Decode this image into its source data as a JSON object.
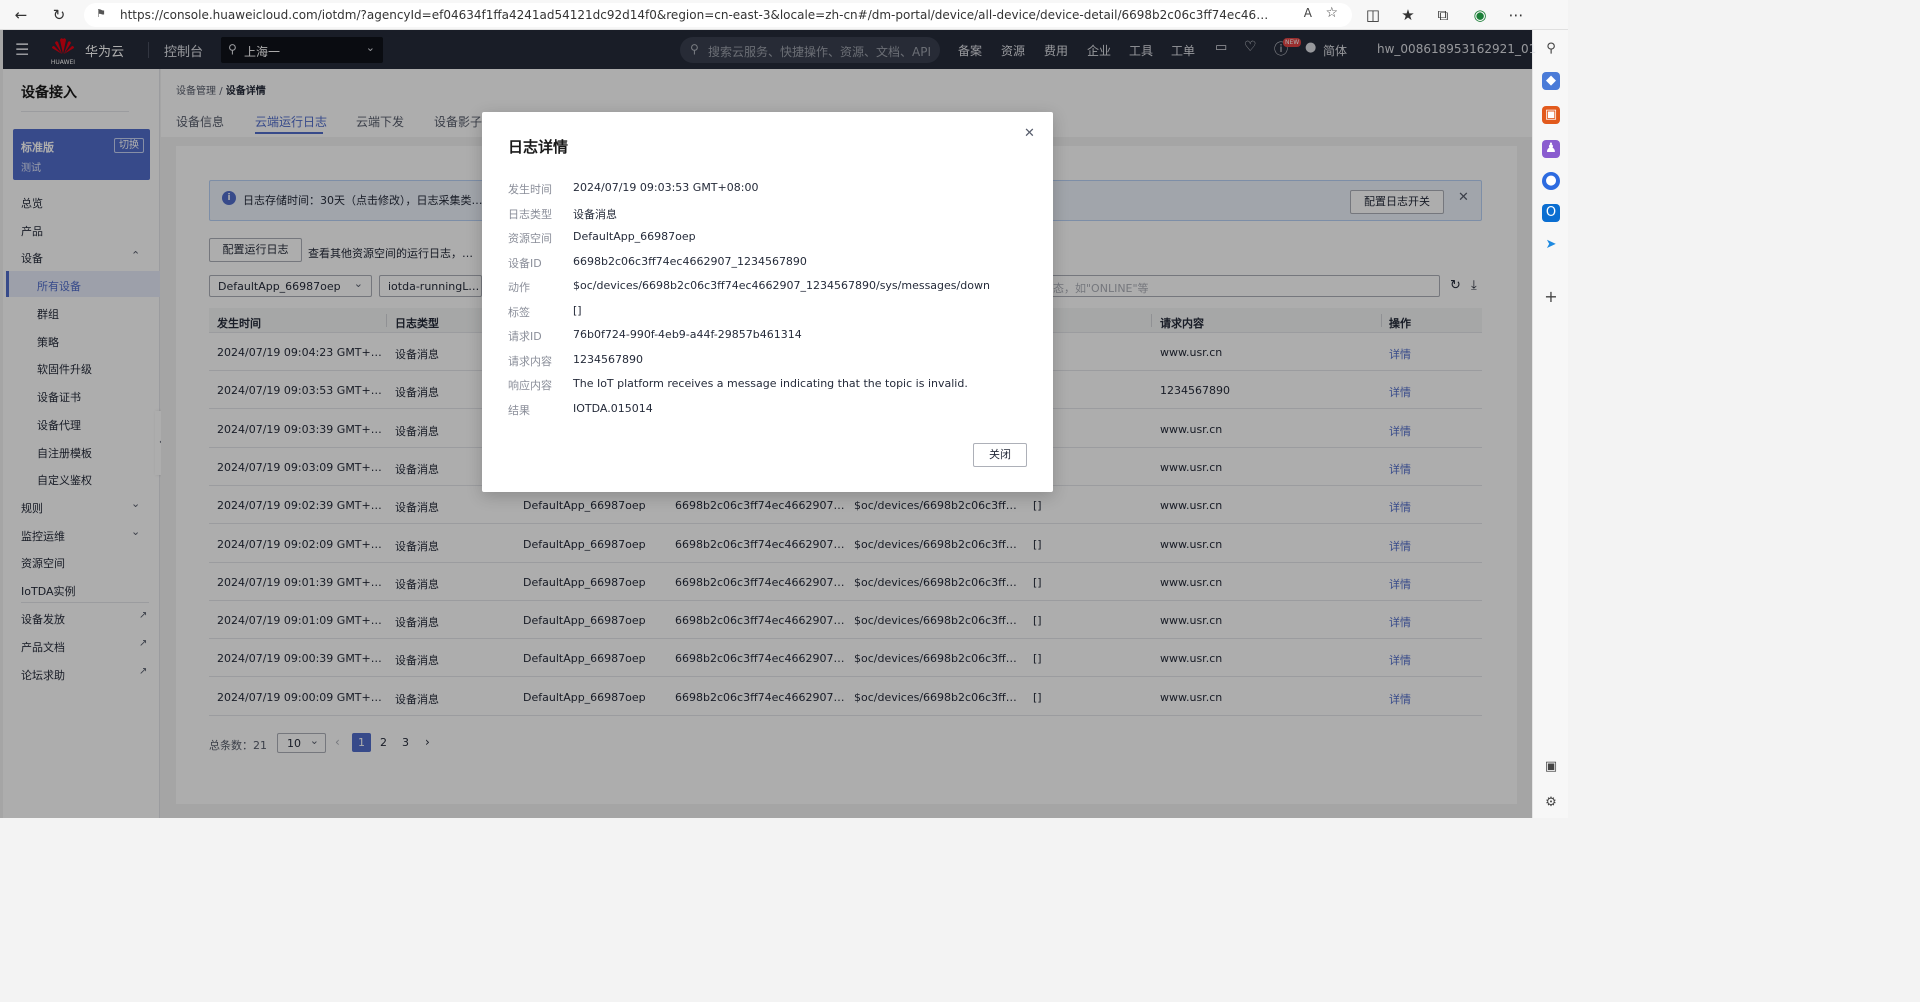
{
  "browser": {
    "url": "https://console.huaweicloud.com/iotdm/?agencyId=ef04634f1ffa4241ad54121dc92d14f0&region=cn-east-3&locale=zh-cn#/dm-portal/device/all-device/device-detail/6698b2c06c3ff74ec4662907_1234567890?appId=2ef6f4c35f..."
  },
  "header": {
    "brand": "华为云",
    "logo_text": "HUAWEI",
    "console": "控制台",
    "region": "上海一",
    "search_placeholder": "搜索云服务、快捷操作、资源、文档、API",
    "nav": [
      "备案",
      "资源",
      "费用",
      "企业",
      "工具",
      "工单"
    ],
    "new_badge": "NEW",
    "lang": "简体",
    "user": "hw_008618953162921_01"
  },
  "sidebar": {
    "title": "设备接入",
    "edition": "标准版",
    "switch_label": "切换",
    "instance": "测试",
    "items": {
      "overview": "总览",
      "product": "产品",
      "device": "设备",
      "all_devices": "所有设备",
      "group": "群组",
      "policy": "策略",
      "firmware": "软固件升级",
      "cert": "设备证书",
      "proxy": "设备代理",
      "self_reg": "自注册模板",
      "custom_auth": "自定义鉴权",
      "rules": "规则",
      "monitor": "监控运维",
      "resource_space": "资源空间",
      "iotda_instance": "IoTDA实例",
      "provisioning": "设备发放",
      "product_docs": "产品文档",
      "forum": "论坛求助"
    }
  },
  "breadcrumb": {
    "parent": "设备管理",
    "sep": "/",
    "current": "设备详情"
  },
  "tabs": [
    "设备信息",
    "云端运行日志",
    "云端下发",
    "设备影子"
  ],
  "notice": {
    "text": "日志存储时间：30天（点击修改），日志采集类型开启",
    "config_button": "配置日志开关"
  },
  "toolbar": {
    "config_button": "配置运行日志",
    "hint": "查看其他资源空间的运行日志，请先配置",
    "space_select": "DefaultApp_66987oep",
    "group_select": "iotda-runningLog-grou",
    "filter_placeholder": "态，如\"ONLINE\"等"
  },
  "table": {
    "headers": {
      "time": "发生时间",
      "type": "日志类型",
      "request": "请求内容",
      "op": "操作"
    },
    "detail_label": "详情",
    "rows": [
      {
        "time": "2024/07/19 09:04:23 GMT+08:00",
        "type": "设备消息",
        "space": "",
        "device": "",
        "action": "",
        "tag": "",
        "request": "www.usr.cn"
      },
      {
        "time": "2024/07/19 09:03:53 GMT+08:00",
        "type": "设备消息",
        "space": "",
        "device": "",
        "action": "",
        "tag": "",
        "request": "1234567890"
      },
      {
        "time": "2024/07/19 09:03:39 GMT+08:00",
        "type": "设备消息",
        "space": "",
        "device": "",
        "action": "",
        "tag": "",
        "request": "www.usr.cn"
      },
      {
        "time": "2024/07/19 09:03:09 GMT+08:00",
        "type": "设备消息",
        "space": "",
        "device": "",
        "action": "",
        "tag": "",
        "request": "www.usr.cn"
      },
      {
        "time": "2024/07/19 09:02:39 GMT+08:00",
        "type": "设备消息",
        "space": "DefaultApp_66987oep",
        "device": "6698b2c06c3ff74ec4662907_...",
        "action": "$oc/devices/6698b2c06c3ff74ec46...",
        "tag": "[]",
        "request": "www.usr.cn"
      },
      {
        "time": "2024/07/19 09:02:09 GMT+08:00",
        "type": "设备消息",
        "space": "DefaultApp_66987oep",
        "device": "6698b2c06c3ff74ec4662907_...",
        "action": "$oc/devices/6698b2c06c3ff74ec46...",
        "tag": "[]",
        "request": "www.usr.cn"
      },
      {
        "time": "2024/07/19 09:01:39 GMT+08:00",
        "type": "设备消息",
        "space": "DefaultApp_66987oep",
        "device": "6698b2c06c3ff74ec4662907_...",
        "action": "$oc/devices/6698b2c06c3ff74ec46...",
        "tag": "[]",
        "request": "www.usr.cn"
      },
      {
        "time": "2024/07/19 09:01:09 GMT+08:00",
        "type": "设备消息",
        "space": "DefaultApp_66987oep",
        "device": "6698b2c06c3ff74ec4662907_...",
        "action": "$oc/devices/6698b2c06c3ff74ec46...",
        "tag": "[]",
        "request": "www.usr.cn"
      },
      {
        "time": "2024/07/19 09:00:39 GMT+08:00",
        "type": "设备消息",
        "space": "DefaultApp_66987oep",
        "device": "6698b2c06c3ff74ec4662907_...",
        "action": "$oc/devices/6698b2c06c3ff74ec46...",
        "tag": "[]",
        "request": "www.usr.cn"
      },
      {
        "time": "2024/07/19 09:00:09 GMT+08:00",
        "type": "设备消息",
        "space": "DefaultApp_66987oep",
        "device": "6698b2c06c3ff74ec4662907_...",
        "action": "$oc/devices/6698b2c06c3ff74ec46...",
        "tag": "[]",
        "request": "www.usr.cn"
      }
    ]
  },
  "pagination": {
    "total_label": "总条数：21",
    "page_size": "10",
    "pages": [
      "1",
      "2",
      "3"
    ],
    "current": "1"
  },
  "dialog": {
    "title": "日志详情",
    "close_button": "关闭",
    "fields": [
      {
        "label": "发生时间",
        "value": "2024/07/19 09:03:53 GMT+08:00"
      },
      {
        "label": "日志类型",
        "value": "设备消息"
      },
      {
        "label": "资源空间",
        "value": "DefaultApp_66987oep"
      },
      {
        "label": "设备ID",
        "value": "6698b2c06c3ff74ec4662907_1234567890"
      },
      {
        "label": "动作",
        "value": "$oc/devices/6698b2c06c3ff74ec4662907_1234567890/sys/messages/down"
      },
      {
        "label": "标签",
        "value": "[]"
      },
      {
        "label": "请求ID",
        "value": "76b0f724-990f-4eb9-a44f-29857b461314"
      },
      {
        "label": "请求内容",
        "value": "1234567890"
      },
      {
        "label": "响应内容",
        "value": "The IoT platform receives a message indicating that the topic is invalid."
      },
      {
        "label": "结果",
        "value": "IOTDA.015014"
      }
    ]
  },
  "colors": {
    "accent": "#526ecc",
    "header_bg": "#252b3a",
    "edition_bg": "#526ecc"
  }
}
